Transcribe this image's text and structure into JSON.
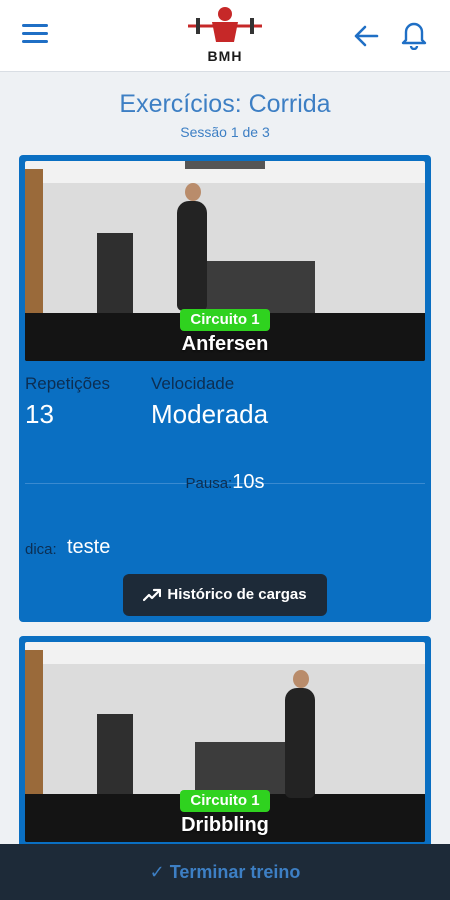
{
  "header": {
    "logo_text": "BMH",
    "icons": {
      "menu": "hamburger-menu-icon",
      "back": "arrow-left-icon",
      "notifications": "bell-icon"
    }
  },
  "page": {
    "title": "Exercícios: Corrida",
    "subtitle": "Sessão 1 de 3"
  },
  "exercises": [
    {
      "circuit": "Circuito 1",
      "name": "Anfersen",
      "reps_label": "Repetições",
      "reps_value": "13",
      "speed_label": "Velocidade",
      "speed_value": "Moderada",
      "pause_label": "Pausa:",
      "pause_value": "10s",
      "tip_label": "dica:",
      "tip_value": "teste",
      "history_button": "Histórico de cargas"
    },
    {
      "circuit": "Circuito 1",
      "name": "Dribbling"
    }
  ],
  "footer": {
    "finish_button": "✓ Terminar treino"
  },
  "colors": {
    "accent": "#3d7fc4",
    "card": "#0a6fc2",
    "dark": "#1d2a38",
    "badge": "#2fd21f"
  }
}
